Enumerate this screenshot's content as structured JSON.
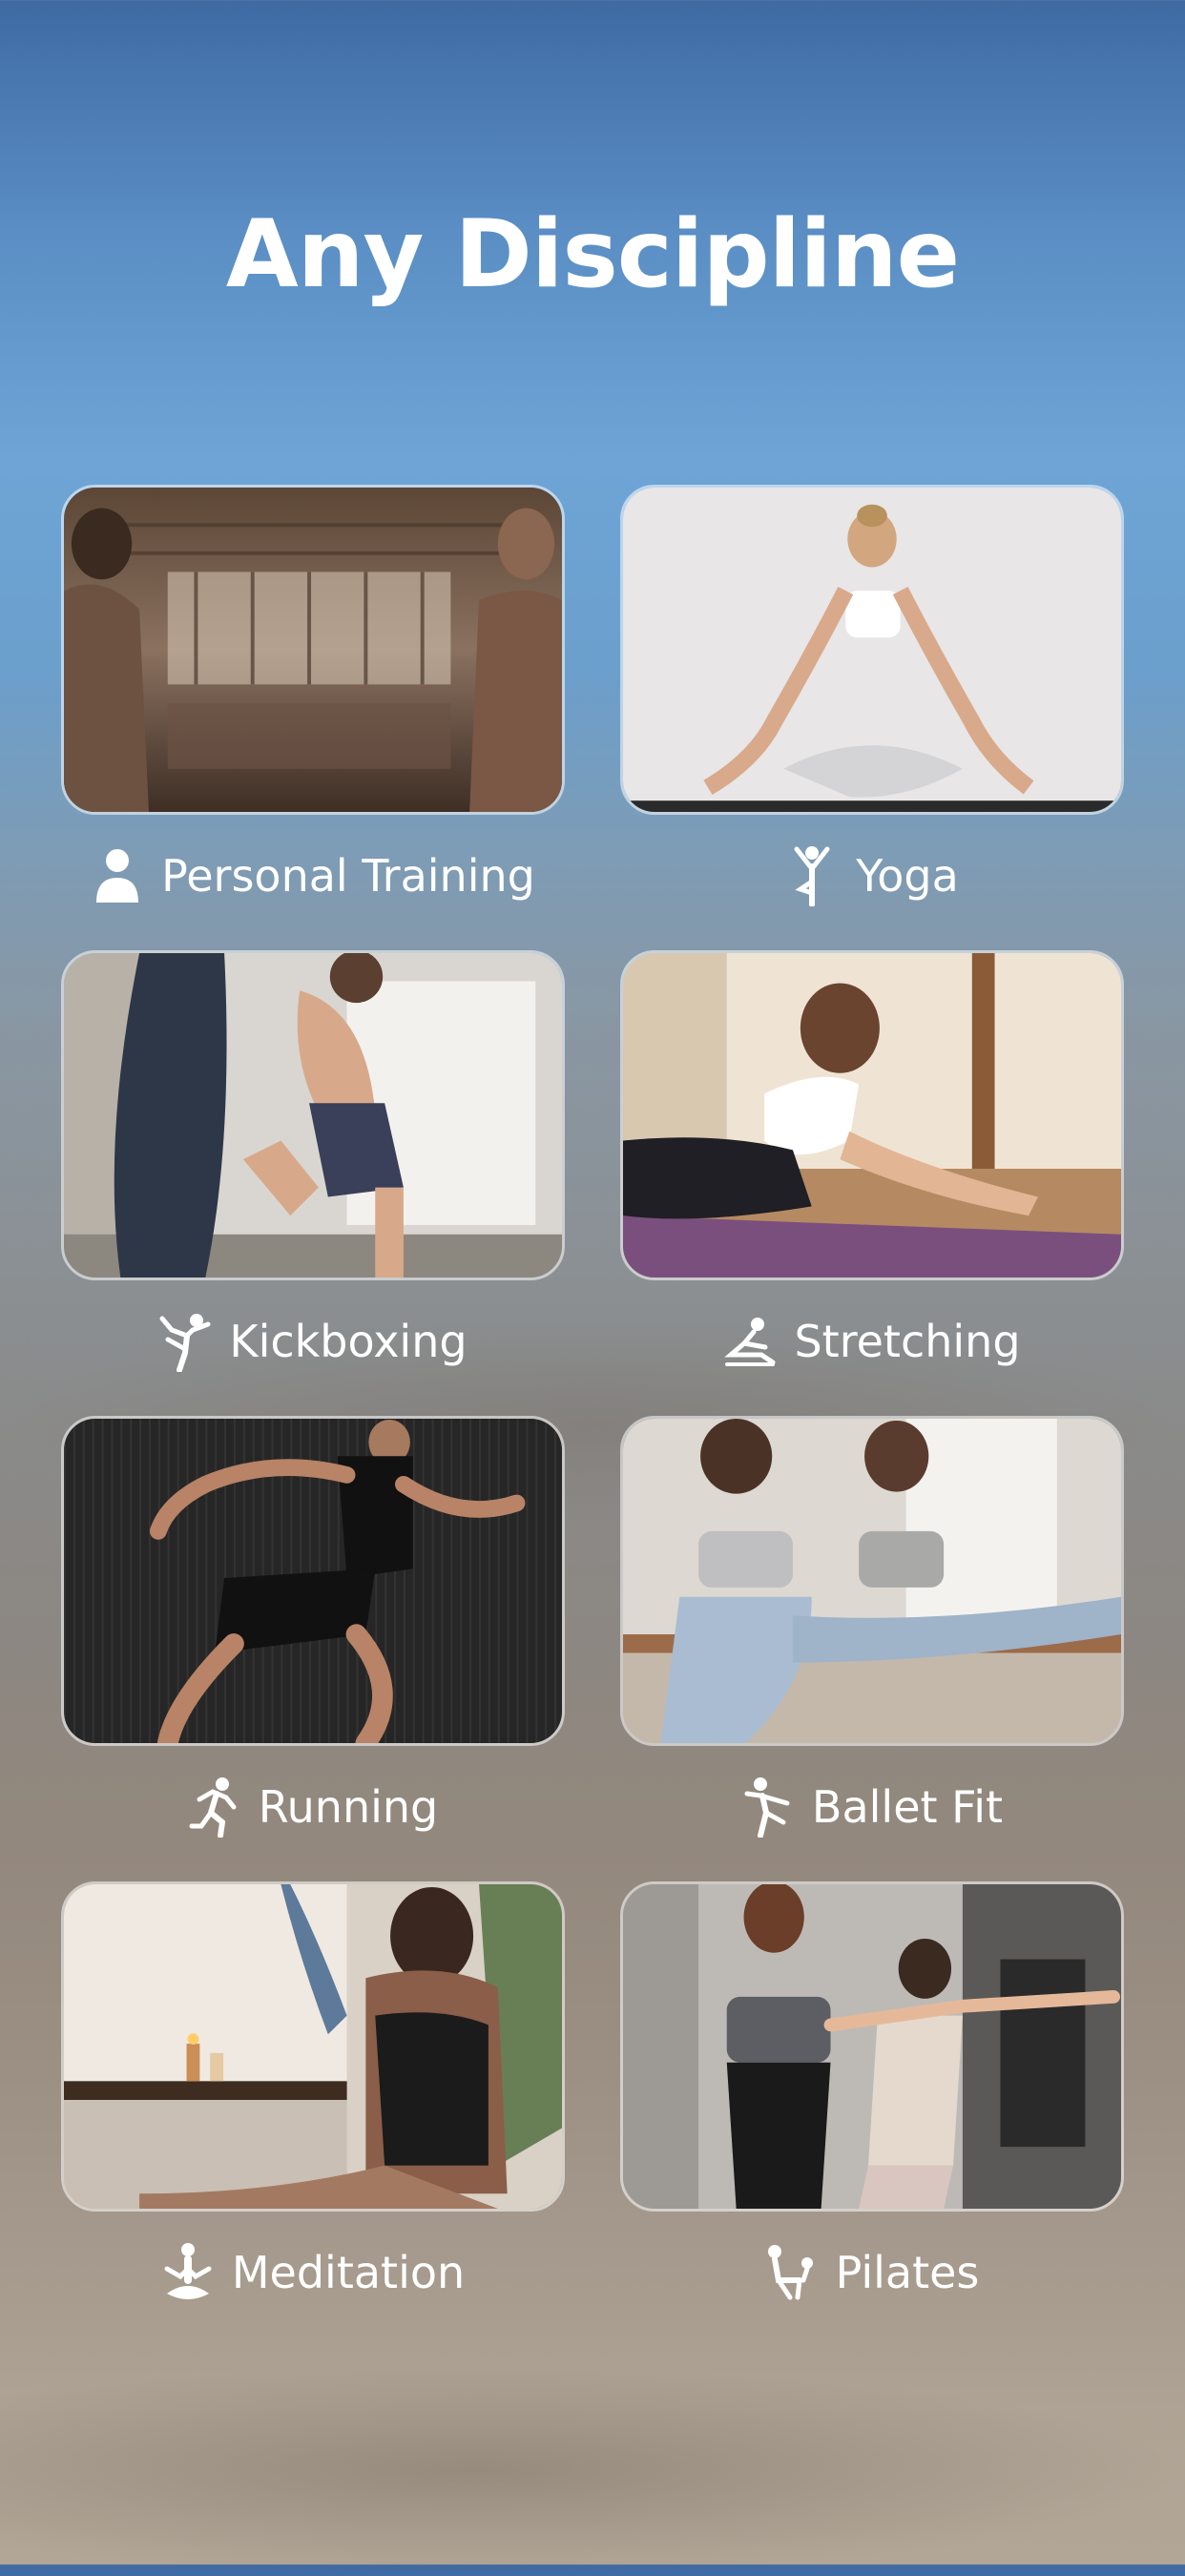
{
  "title": "Any Discipline",
  "disciplines": [
    {
      "label": "Personal Training",
      "icon": "person-icon"
    },
    {
      "label": "Yoga",
      "icon": "yoga-pose-icon"
    },
    {
      "label": "Kickboxing",
      "icon": "kick-icon"
    },
    {
      "label": "Stretching",
      "icon": "stretch-icon"
    },
    {
      "label": "Running",
      "icon": "running-icon"
    },
    {
      "label": "Ballet Fit",
      "icon": "ballet-icon"
    },
    {
      "label": "Meditation",
      "icon": "meditation-icon"
    },
    {
      "label": "Pilates",
      "icon": "pilates-icon"
    }
  ],
  "colors": {
    "sky_top": "#3f6aa3",
    "sky_mid": "#6ea5d6",
    "sand_bottom": "#b2a797",
    "text": "#ffffff"
  }
}
